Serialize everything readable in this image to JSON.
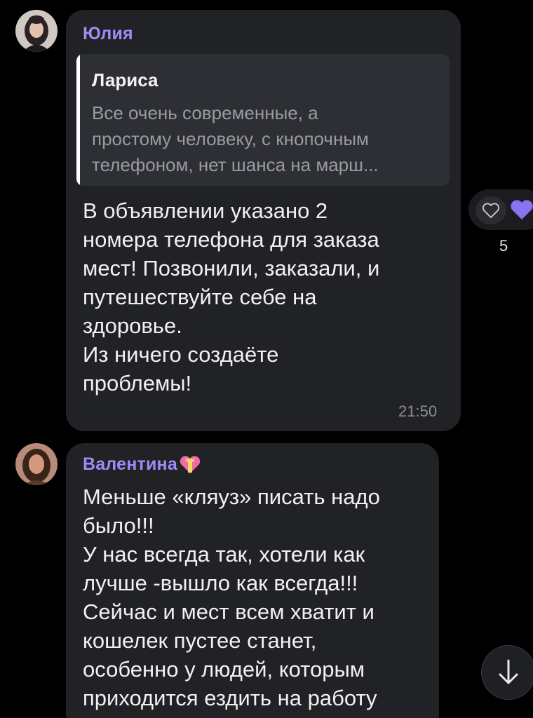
{
  "messages": [
    {
      "sender": "Юлия",
      "reply": {
        "author": "Лариса",
        "text": "Все очень современные, а\nпростому человеку, с кнопочным\nтелефоном, нет шанса на марш..."
      },
      "text": "В объявлении указано 2\nномера телефона для заказа\nмест! Позвонили, заказали, и\nпутешествуйте себе на\nздоровье.\nИз ничего создаёте\nпроблемы!",
      "time": "21:50",
      "reactions": [
        {
          "icon": "heart-outline-icon"
        },
        {
          "icon": "purple-heart-icon",
          "count": "5"
        }
      ]
    },
    {
      "sender": "Валентина",
      "sender_emoji": "heart-with-ribbon-icon",
      "text": "Меньше «кляуз» писать надо\nбыло!!!\nУ нас всегда так, хотели как\nлучше -вышло как всегда!!!\nСейчас и мест всем хватит и\nкошелек пустее станет,\nособенно у людей, которым\nприходится ездить на работу"
    }
  ],
  "colors": {
    "background": "#000000",
    "bubble": "#212226",
    "reply_box": "#2e2f34",
    "sender_name": "#9e8cf5",
    "text": "#f1f1f1",
    "muted": "#8d8e93",
    "heart": "#8a73f0"
  },
  "scroll_button_icon": "arrow-down-icon"
}
